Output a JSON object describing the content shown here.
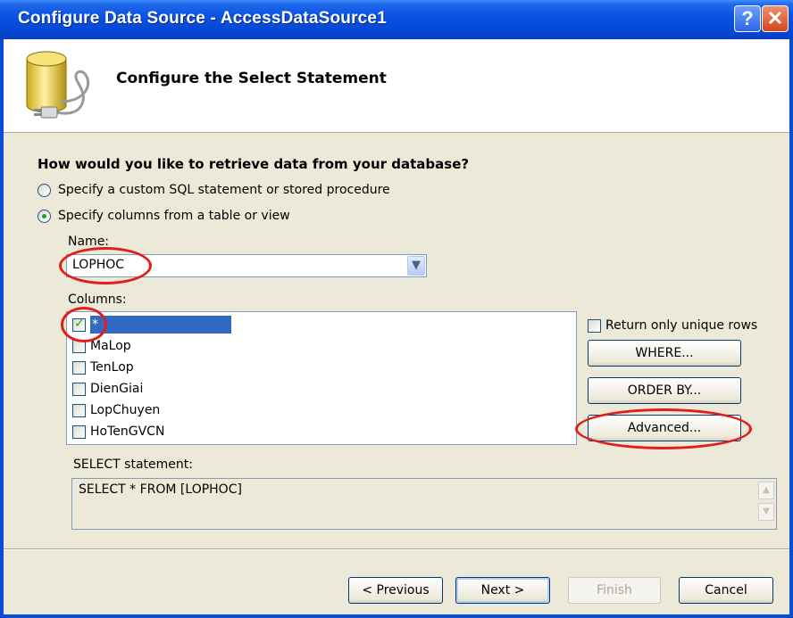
{
  "window": {
    "title": "Configure Data Source - AccessDataSource1",
    "help_label": "?",
    "close_label": "✕"
  },
  "header": {
    "title": "Configure the Select Statement",
    "icon": "database-plug-icon"
  },
  "question": "How would you like to retrieve data from your database?",
  "options": [
    {
      "label": "Specify a custom SQL statement or stored procedure",
      "selected": false
    },
    {
      "label": "Specify columns from a table or view",
      "selected": true
    }
  ],
  "name_field": {
    "label": "Name:",
    "value": "LOPHOC"
  },
  "columns": {
    "label": "Columns:",
    "items": [
      {
        "label": "*",
        "checked": true,
        "selected": true
      },
      {
        "label": "MaLop",
        "checked": false,
        "selected": false
      },
      {
        "label": "TenLop",
        "checked": false,
        "selected": false
      },
      {
        "label": "DienGiai",
        "checked": false,
        "selected": false
      },
      {
        "label": "LopChuyen",
        "checked": false,
        "selected": false
      },
      {
        "label": "HoTenGVCN",
        "checked": false,
        "selected": false
      }
    ]
  },
  "side_panel": {
    "unique_rows_label": "Return only unique rows",
    "unique_rows_checked": false,
    "where_label": "WHERE...",
    "order_by_label": "ORDER BY...",
    "advanced_label": "Advanced..."
  },
  "select_statement": {
    "label": "SELECT statement:",
    "value": "SELECT * FROM [LOPHOC]"
  },
  "footer": {
    "previous_label": "< Previous",
    "next_label": "Next >",
    "finish_label": "Finish",
    "cancel_label": "Cancel"
  },
  "colors": {
    "annotation": "#e11e1e",
    "title_bar": "#0a53e4",
    "selection": "#316ac5"
  }
}
